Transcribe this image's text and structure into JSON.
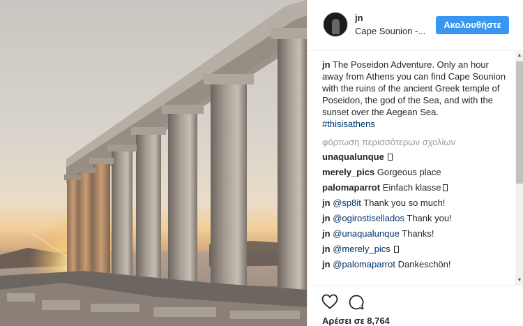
{
  "post": {
    "image_alt": "Temple of Poseidon at Cape Sounion at sunset",
    "header": {
      "username": "jn",
      "location": "Cape Sounion -...",
      "follow_label": "Ακολουθήστε"
    },
    "caption": {
      "username": "jn",
      "text": "The Poseidon Adventure. Only an hour away from Athens you can find Cape Sounion with the ruins of the ancient Greek temple of Poseidon, the god of the Sea, and with the sunset over the Aegean Sea.",
      "hashtag": "#thisisathens"
    },
    "load_more_label": "φόρτωση περισσότερων σχολίων",
    "comments": [
      {
        "user": "unaqualunque",
        "mention": "",
        "text": "",
        "glyph": true
      },
      {
        "user": "merely_pics",
        "mention": "",
        "text": "Gorgeous place",
        "glyph": false
      },
      {
        "user": "palomaparrot",
        "mention": "",
        "text": "Einfach klasse",
        "glyph": true
      },
      {
        "user": "jn",
        "mention": "@sp8it",
        "text": "Thank you so much!",
        "glyph": false
      },
      {
        "user": "jn",
        "mention": "@ogirostisellados",
        "text": "Thank you!",
        "glyph": false
      },
      {
        "user": "jn",
        "mention": "@unaqualunque",
        "text": "Thanks!",
        "glyph": false
      },
      {
        "user": "jn",
        "mention": "@merely_pics",
        "text": "",
        "glyph": true
      },
      {
        "user": "jn",
        "mention": "@palomaparrot",
        "text": "Dankeschön!",
        "glyph": false
      }
    ],
    "actions": {
      "like_icon": "heart-icon",
      "comment_icon": "comment-icon",
      "likes_text": "Αρέσει σε 8,764"
    },
    "scrollbar": {
      "up_glyph": "▲",
      "down_glyph": "▼"
    }
  },
  "colors": {
    "follow_button": "#3897f0",
    "link": "#003569",
    "muted": "#999999"
  }
}
